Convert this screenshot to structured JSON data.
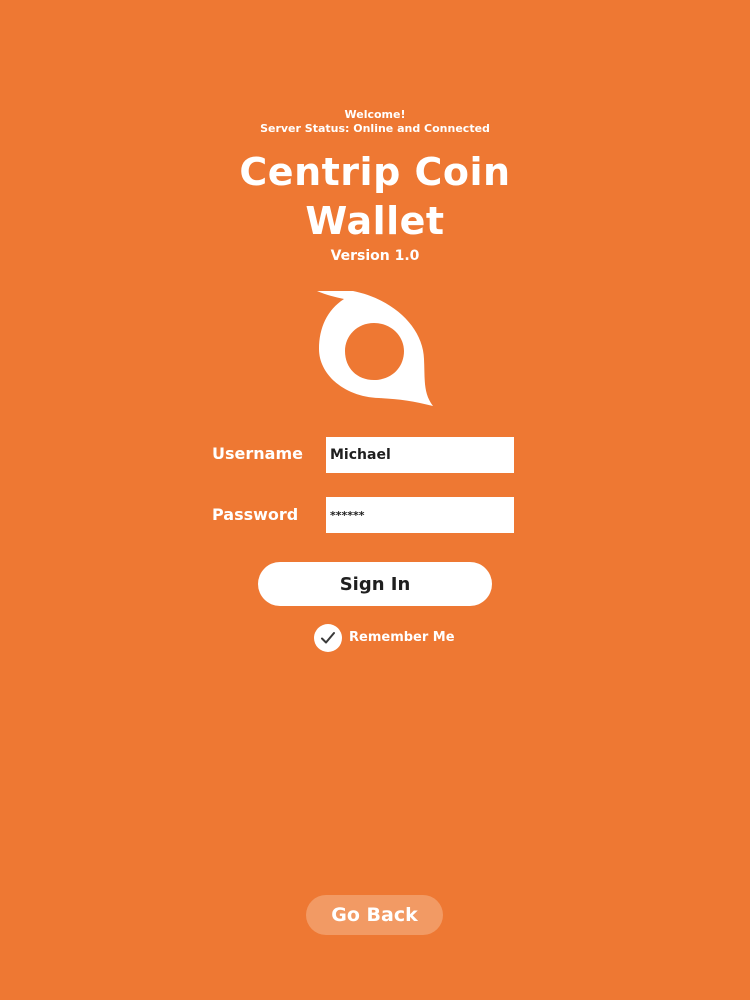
{
  "header": {
    "welcome": "Welcome!",
    "server_status": "Server Status: Online and Connected"
  },
  "app": {
    "title_line1": "Centrip Coin",
    "title_line2": "Wallet",
    "version": "Version 1.0"
  },
  "logo": {
    "icon": "centrip-coin-logo-icon",
    "color": "#ffffff"
  },
  "form": {
    "username_label": "Username",
    "username_value": "Michael",
    "password_label": "Password",
    "password_value": "******",
    "sign_in_label": "Sign In",
    "remember_me_label": "Remember Me",
    "remember_me_checked": true,
    "checkbox_icon": "checkmark-icon"
  },
  "footer": {
    "go_back_label": "Go Back"
  },
  "colors": {
    "background": "#ee7833",
    "go_back_button": "#f29a64",
    "text_light": "#ffffff",
    "text_dark": "#1f1f1f"
  }
}
